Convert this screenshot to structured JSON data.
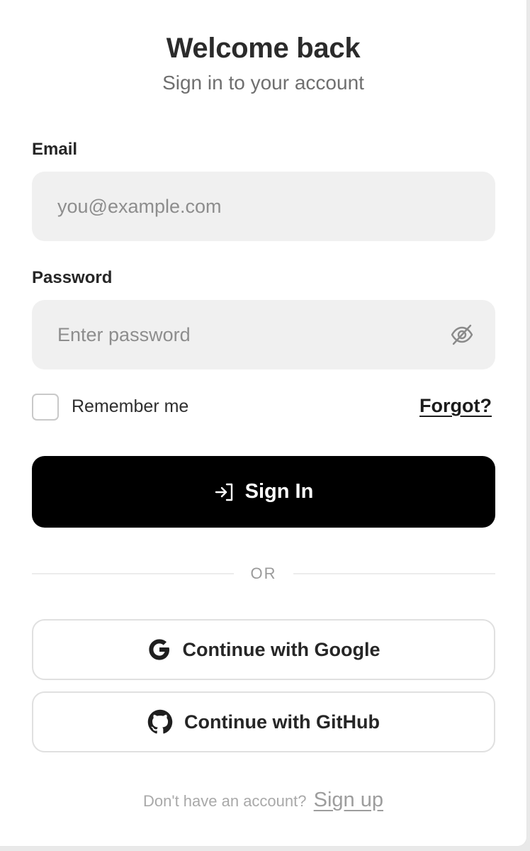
{
  "header": {
    "title": "Welcome back",
    "subtitle": "Sign in to your account"
  },
  "email": {
    "label": "Email",
    "placeholder": "you@example.com",
    "value": ""
  },
  "password": {
    "label": "Password",
    "placeholder": "Enter password",
    "value": "",
    "toggle_icon": "eye-off-icon"
  },
  "remember": {
    "label": "Remember me",
    "checked": false
  },
  "forgot": {
    "label": "Forgot?"
  },
  "signin": {
    "label": "Sign In",
    "icon": "login-icon"
  },
  "divider": {
    "label": "OR"
  },
  "social": {
    "google_label": "Continue with Google",
    "google_icon": "google-icon",
    "github_label": "Continue with GitHub",
    "github_icon": "github-icon"
  },
  "footer": {
    "prompt": "Don't have an account?",
    "signup_label": "Sign up"
  },
  "colors": {
    "primary_button": "#000000",
    "field_background": "#f0f0f0",
    "text": "#2b2b2b",
    "muted": "#6f6f6f"
  }
}
